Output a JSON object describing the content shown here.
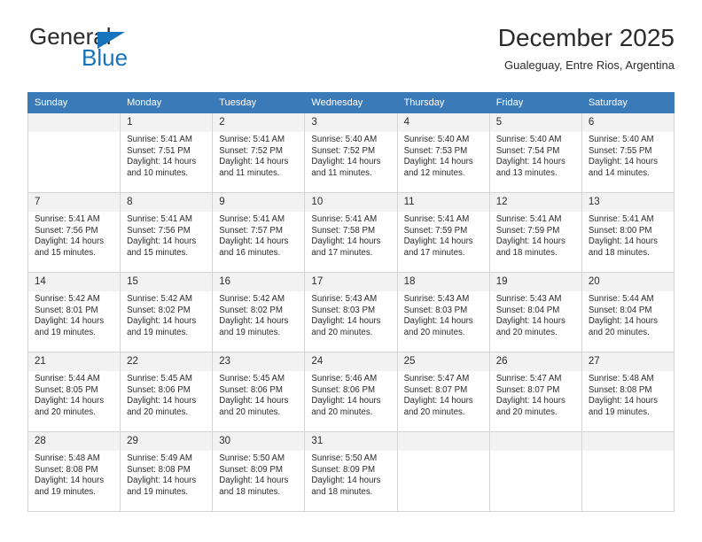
{
  "brand": {
    "name_part1": "General",
    "name_part2": "Blue",
    "triangle_color": "#1673bc",
    "text_color": "#2b2b2b"
  },
  "header": {
    "title": "December 2025",
    "subtitle": "Gualeguay, Entre Rios, Argentina"
  },
  "theme": {
    "header_row_bg": "#3a7ab9",
    "header_row_text": "#ffffff",
    "daynum_bg": "#f2f2f2",
    "cell_border": "#d4d4d4",
    "page_bg": "#ffffff"
  },
  "calendar": {
    "weekday_headers": [
      "Sunday",
      "Monday",
      "Tuesday",
      "Wednesday",
      "Thursday",
      "Friday",
      "Saturday"
    ],
    "weeks": [
      [
        {
          "day": "",
          "sunrise": "",
          "sunset": "",
          "daylight": ""
        },
        {
          "day": "1",
          "sunrise": "Sunrise: 5:41 AM",
          "sunset": "Sunset: 7:51 PM",
          "daylight": "Daylight: 14 hours and 10 minutes."
        },
        {
          "day": "2",
          "sunrise": "Sunrise: 5:41 AM",
          "sunset": "Sunset: 7:52 PM",
          "daylight": "Daylight: 14 hours and 11 minutes."
        },
        {
          "day": "3",
          "sunrise": "Sunrise: 5:40 AM",
          "sunset": "Sunset: 7:52 PM",
          "daylight": "Daylight: 14 hours and 11 minutes."
        },
        {
          "day": "4",
          "sunrise": "Sunrise: 5:40 AM",
          "sunset": "Sunset: 7:53 PM",
          "daylight": "Daylight: 14 hours and 12 minutes."
        },
        {
          "day": "5",
          "sunrise": "Sunrise: 5:40 AM",
          "sunset": "Sunset: 7:54 PM",
          "daylight": "Daylight: 14 hours and 13 minutes."
        },
        {
          "day": "6",
          "sunrise": "Sunrise: 5:40 AM",
          "sunset": "Sunset: 7:55 PM",
          "daylight": "Daylight: 14 hours and 14 minutes."
        }
      ],
      [
        {
          "day": "7",
          "sunrise": "Sunrise: 5:41 AM",
          "sunset": "Sunset: 7:56 PM",
          "daylight": "Daylight: 14 hours and 15 minutes."
        },
        {
          "day": "8",
          "sunrise": "Sunrise: 5:41 AM",
          "sunset": "Sunset: 7:56 PM",
          "daylight": "Daylight: 14 hours and 15 minutes."
        },
        {
          "day": "9",
          "sunrise": "Sunrise: 5:41 AM",
          "sunset": "Sunset: 7:57 PM",
          "daylight": "Daylight: 14 hours and 16 minutes."
        },
        {
          "day": "10",
          "sunrise": "Sunrise: 5:41 AM",
          "sunset": "Sunset: 7:58 PM",
          "daylight": "Daylight: 14 hours and 17 minutes."
        },
        {
          "day": "11",
          "sunrise": "Sunrise: 5:41 AM",
          "sunset": "Sunset: 7:59 PM",
          "daylight": "Daylight: 14 hours and 17 minutes."
        },
        {
          "day": "12",
          "sunrise": "Sunrise: 5:41 AM",
          "sunset": "Sunset: 7:59 PM",
          "daylight": "Daylight: 14 hours and 18 minutes."
        },
        {
          "day": "13",
          "sunrise": "Sunrise: 5:41 AM",
          "sunset": "Sunset: 8:00 PM",
          "daylight": "Daylight: 14 hours and 18 minutes."
        }
      ],
      [
        {
          "day": "14",
          "sunrise": "Sunrise: 5:42 AM",
          "sunset": "Sunset: 8:01 PM",
          "daylight": "Daylight: 14 hours and 19 minutes."
        },
        {
          "day": "15",
          "sunrise": "Sunrise: 5:42 AM",
          "sunset": "Sunset: 8:02 PM",
          "daylight": "Daylight: 14 hours and 19 minutes."
        },
        {
          "day": "16",
          "sunrise": "Sunrise: 5:42 AM",
          "sunset": "Sunset: 8:02 PM",
          "daylight": "Daylight: 14 hours and 19 minutes."
        },
        {
          "day": "17",
          "sunrise": "Sunrise: 5:43 AM",
          "sunset": "Sunset: 8:03 PM",
          "daylight": "Daylight: 14 hours and 20 minutes."
        },
        {
          "day": "18",
          "sunrise": "Sunrise: 5:43 AM",
          "sunset": "Sunset: 8:03 PM",
          "daylight": "Daylight: 14 hours and 20 minutes."
        },
        {
          "day": "19",
          "sunrise": "Sunrise: 5:43 AM",
          "sunset": "Sunset: 8:04 PM",
          "daylight": "Daylight: 14 hours and 20 minutes."
        },
        {
          "day": "20",
          "sunrise": "Sunrise: 5:44 AM",
          "sunset": "Sunset: 8:04 PM",
          "daylight": "Daylight: 14 hours and 20 minutes."
        }
      ],
      [
        {
          "day": "21",
          "sunrise": "Sunrise: 5:44 AM",
          "sunset": "Sunset: 8:05 PM",
          "daylight": "Daylight: 14 hours and 20 minutes."
        },
        {
          "day": "22",
          "sunrise": "Sunrise: 5:45 AM",
          "sunset": "Sunset: 8:06 PM",
          "daylight": "Daylight: 14 hours and 20 minutes."
        },
        {
          "day": "23",
          "sunrise": "Sunrise: 5:45 AM",
          "sunset": "Sunset: 8:06 PM",
          "daylight": "Daylight: 14 hours and 20 minutes."
        },
        {
          "day": "24",
          "sunrise": "Sunrise: 5:46 AM",
          "sunset": "Sunset: 8:06 PM",
          "daylight": "Daylight: 14 hours and 20 minutes."
        },
        {
          "day": "25",
          "sunrise": "Sunrise: 5:47 AM",
          "sunset": "Sunset: 8:07 PM",
          "daylight": "Daylight: 14 hours and 20 minutes."
        },
        {
          "day": "26",
          "sunrise": "Sunrise: 5:47 AM",
          "sunset": "Sunset: 8:07 PM",
          "daylight": "Daylight: 14 hours and 20 minutes."
        },
        {
          "day": "27",
          "sunrise": "Sunrise: 5:48 AM",
          "sunset": "Sunset: 8:08 PM",
          "daylight": "Daylight: 14 hours and 19 minutes."
        }
      ],
      [
        {
          "day": "28",
          "sunrise": "Sunrise: 5:48 AM",
          "sunset": "Sunset: 8:08 PM",
          "daylight": "Daylight: 14 hours and 19 minutes."
        },
        {
          "day": "29",
          "sunrise": "Sunrise: 5:49 AM",
          "sunset": "Sunset: 8:08 PM",
          "daylight": "Daylight: 14 hours and 19 minutes."
        },
        {
          "day": "30",
          "sunrise": "Sunrise: 5:50 AM",
          "sunset": "Sunset: 8:09 PM",
          "daylight": "Daylight: 14 hours and 18 minutes."
        },
        {
          "day": "31",
          "sunrise": "Sunrise: 5:50 AM",
          "sunset": "Sunset: 8:09 PM",
          "daylight": "Daylight: 14 hours and 18 minutes."
        },
        {
          "day": "",
          "sunrise": "",
          "sunset": "",
          "daylight": ""
        },
        {
          "day": "",
          "sunrise": "",
          "sunset": "",
          "daylight": ""
        },
        {
          "day": "",
          "sunrise": "",
          "sunset": "",
          "daylight": ""
        }
      ]
    ]
  }
}
